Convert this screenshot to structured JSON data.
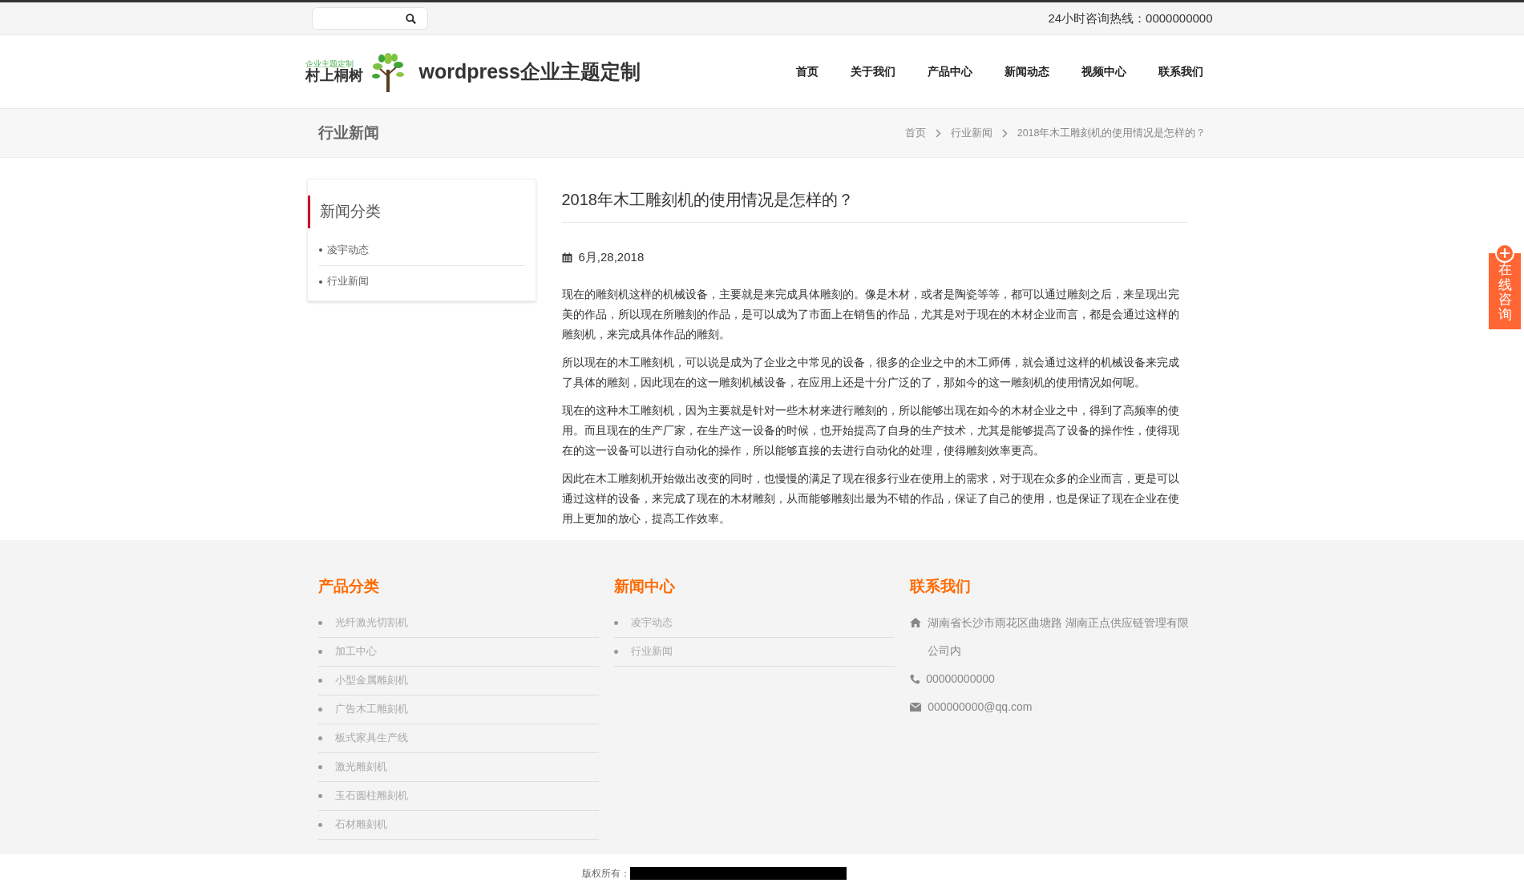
{
  "topbar": {
    "hotline": "24小时咨询热线：0000000000"
  },
  "header": {
    "logo": {
      "tagline": "企业主题定制",
      "name": "村上桐树"
    },
    "site_title": "wordpress企业主题定制",
    "nav": [
      "首页",
      "关于我们",
      "产品中心",
      "新闻动态",
      "视频中心",
      "联系我们"
    ]
  },
  "page_banner": {
    "title": "行业新闻",
    "breadcrumb": [
      "首页",
      "行业新闻",
      "2018年木工雕刻机的使用情况是怎样的？"
    ]
  },
  "sidebar": {
    "title": "新闻分类",
    "items": [
      "凌宇动态",
      "行业新闻"
    ]
  },
  "article": {
    "title": "2018年木工雕刻机的使用情况是怎样的？",
    "date": "6月,28,2018",
    "paragraphs": [
      "现在的雕刻机这样的机械设备，主要就是来完成具体雕刻的。像是木材，或者是陶瓷等等，都可以通过雕刻之后，来呈现出完美的作品，所以现在所雕刻的作品，是可以成为了市面上在销售的作品，尤其是对于现在的木材企业而言，都是会通过这样的雕刻机，来完成具体作品的雕刻。",
      "所以现在的木工雕刻机，可以说是成为了企业之中常见的设备，很多的企业之中的木工师傅，就会通过这样的机械设备来完成了具体的雕刻，因此现在的这一雕刻机械设备，在应用上还是十分广泛的了，那如今的这一雕刻机的使用情况如何呢。",
      "现在的这种木工雕刻机，因为主要就是针对一些木材来进行雕刻的，所以能够出现在如今的木材企业之中，得到了高频率的使用。而且现在的生产厂家，在生产这一设备的时候，也开始提高了自身的生产技术，尤其是能够提高了设备的操作性，使得现在的这一设备可以进行自动化的操作，所以能够直接的去进行自动化的处理，使得雕刻效率更高。",
      "因此在木工雕刻机开始做出改变的同时，也慢慢的满足了现在很多行业在使用上的需求，对于现在众多的企业而言，更是可以通过这样的设备，来完成了现在的木材雕刻，从而能够雕刻出最为不错的作品，保证了自己的使用，也是保证了现在企业在使用上更加的放心，提高工作效率。"
    ]
  },
  "footer": {
    "columns": [
      {
        "kind": "list",
        "title": "产品分类",
        "items": [
          "光纤激光切割机",
          "加工中心",
          "小型金属雕刻机",
          "广告木工雕刻机",
          "板式家具生产线",
          "激光雕刻机",
          "玉石圆柱雕刻机",
          "石材雕刻机"
        ]
      },
      {
        "kind": "list",
        "title": "新闻中心",
        "items": [
          "凌宇动态",
          "行业新闻"
        ]
      },
      {
        "kind": "contact",
        "title": "联系我们",
        "address": "湖南省长沙市雨花区曲塘路 湖南正点供应链管理有限公司内",
        "phone": "00000000000",
        "email": "000000000@qq.com"
      }
    ],
    "copyright": "版权所有："
  },
  "float_tab": {
    "label": "在线咨询"
  }
}
